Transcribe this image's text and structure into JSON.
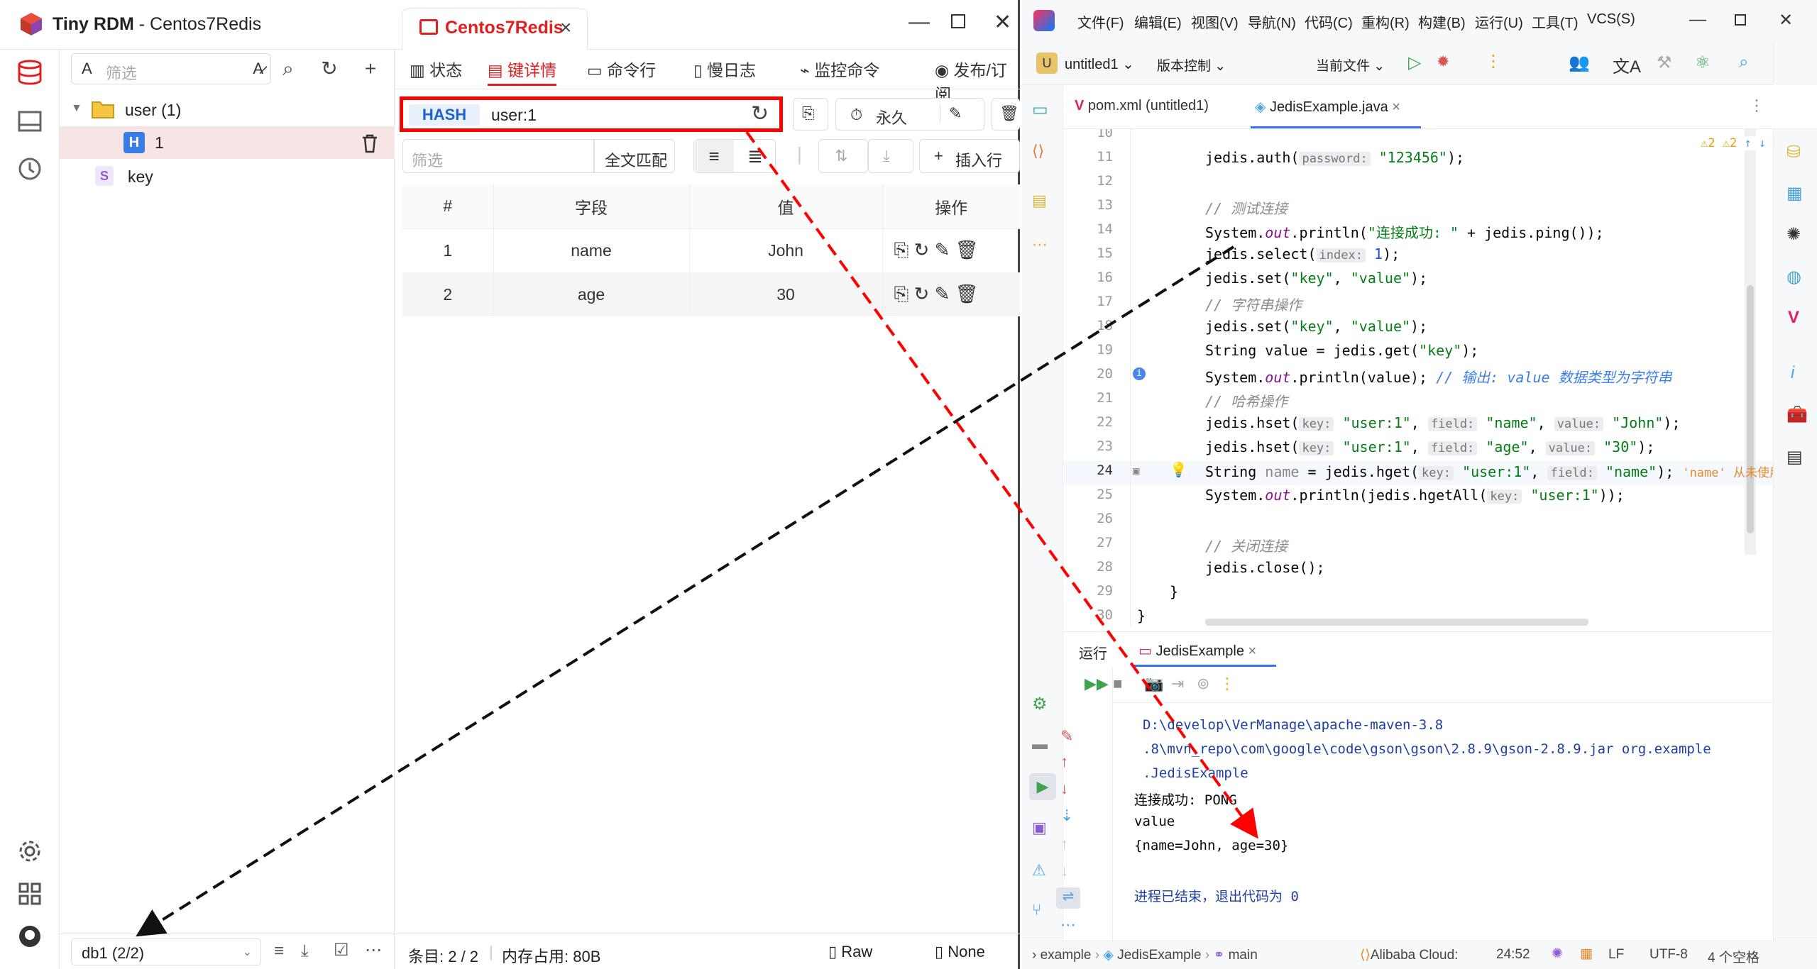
{
  "rdm": {
    "app_name": "Tiny RDM",
    "title_sep": " - ",
    "conn_name": "Centos7Redis",
    "conn_tab_label": "Centos7Redis",
    "filter_placeholder": "筛选",
    "tree": [
      {
        "label": "user (1)",
        "type": "folder"
      },
      {
        "label": "1",
        "type": "H"
      },
      {
        "label": "key",
        "type": "S"
      }
    ],
    "tabs": [
      "状态",
      "键详情",
      "命令行",
      "慢日志",
      "监控命令",
      "发布/订阅"
    ],
    "active_tab": 1,
    "key_type": "HASH",
    "key_name": "user:1",
    "ttl_label": "永久",
    "filter_row": {
      "placeholder": "筛选",
      "match_label": "全文匹配",
      "insert_label": "插入行"
    },
    "table": {
      "headers": [
        "#",
        "字段",
        "值",
        "操作"
      ],
      "rows": [
        {
          "idx": "1",
          "field": "name",
          "value": "John"
        },
        {
          "idx": "2",
          "field": "age",
          "value": "30"
        }
      ]
    },
    "status": {
      "entries": "条目: 2 / 2",
      "memory": "内存占用: 80B",
      "raw": "Raw",
      "none": "None"
    },
    "db_select": "db1 (2/2)"
  },
  "ide": {
    "menus": [
      "文件(F)",
      "编辑(E)",
      "视图(V)",
      "导航(N)",
      "代码(C)",
      "重构(R)",
      "构建(B)",
      "运行(U)",
      "工具(T)",
      "VCS(S)"
    ],
    "project": "untitled1",
    "vcs": "版本控制",
    "run_config": "当前文件",
    "tabs": [
      "pom.xml (untitled1)",
      "JedisExample.java"
    ],
    "warnings": "2",
    "warnings2": "2",
    "line_numbers": [
      "10",
      "11",
      "12",
      "13",
      "14",
      "15",
      "16",
      "17",
      "18",
      "19",
      "20",
      "21",
      "22",
      "23",
      "24",
      "25",
      "26",
      "27",
      "28",
      "29",
      "30"
    ],
    "code": {
      "l11_a": "jedis.auth(",
      "l11_h": "password:",
      "l11_s": "\"123456\"",
      "l11_b": ");",
      "l13": "// 测试连接",
      "l14_a": "System.",
      "l14_f": "out",
      "l14_b": ".println(",
      "l14_s": "\"连接成功: \"",
      "l14_c": " + jedis.ping());",
      "l15_a": "jedis.select(",
      "l15_h": "index:",
      "l15_n": "1",
      "l15_b": ");",
      "l16_a": "jedis.set(",
      "l16_s1": "\"key\"",
      "l16_c": ", ",
      "l16_s2": "\"value\"",
      "l16_b": ");",
      "l17": "// 字符串操作",
      "l18_a": "jedis.set(",
      "l18_s1": "\"key\"",
      "l18_c": ", ",
      "l18_s2": "\"value\"",
      "l18_b": ");",
      "l19_a": "String value = jedis.get(",
      "l19_s": "\"key\"",
      "l19_b": ");",
      "l20_a": "System.",
      "l20_f": "out",
      "l20_b": ".println(value); ",
      "l20_c": "// 输出: value 数据类型为字符串",
      "l21": "// 哈希操作",
      "l22_a": "jedis.hset(",
      "l22_h1": "key:",
      "l22_s1": "\"user:1\"",
      "l22_h2": "field:",
      "l22_s2": "\"name\"",
      "l22_h3": "value:",
      "l22_s3": "\"John\"",
      "l22_b": ");",
      "l23_a": "jedis.hset(",
      "l23_h1": "key:",
      "l23_s1": "\"user:1\"",
      "l23_h2": "field:",
      "l23_s2": "\"age\"",
      "l23_h3": "value:",
      "l23_s3": "\"30\"",
      "l23_b": ");",
      "l24_a": "String ",
      "l24_v": "name",
      "l24_b": " = jedis.hget(",
      "l24_h1": "key:",
      "l24_s1": "\"user:1\"",
      "l24_h2": "field:",
      "l24_s2": "\"name\"",
      "l24_c": ");",
      "l24_w": "'name' 从未使用",
      "l25_a": "System.",
      "l25_f": "out",
      "l25_b": ".println(jedis.hgetAll(",
      "l25_h": "key:",
      "l25_s": "\"user:1\"",
      "l25_c": "));",
      "l27": "// 关闭连接",
      "l28": "jedis.close();",
      "l29": "}",
      "l30": "}"
    },
    "run_label": "运行",
    "run_tab": "JedisExample",
    "console": [
      "D:\\develop\\VerManage\\apache-maven-3.8",
      ".8\\mvn_repo\\com\\google\\code\\gson\\gson\\2.8.9\\gson-2.8.9.jar org.example",
      ".JedisExample",
      "连接成功: PONG",
      "value",
      "{name=John, age=30}",
      "",
      "进程已结束，退出代码为 0"
    ],
    "status": {
      "crumbs": [
        "example",
        "JedisExample",
        "main"
      ],
      "cloud": "Alibaba Cloud:",
      "pos": "24:52",
      "lf": "LF",
      "enc": "UTF-8",
      "indent": "4 个空格"
    }
  },
  "colors": {
    "accent": "#e02020",
    "hash_blue": "#1e63c5"
  }
}
